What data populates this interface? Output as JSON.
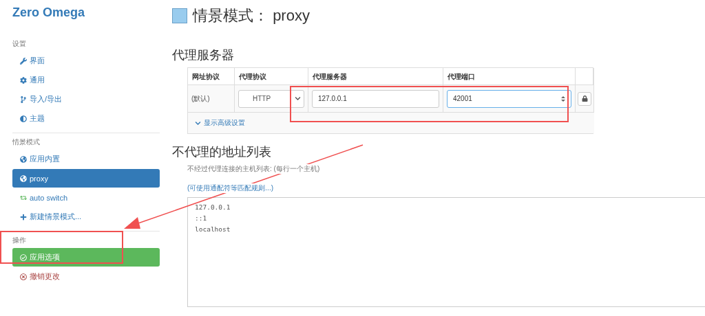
{
  "brand": "Zero Omega",
  "sidebar": {
    "sections": [
      {
        "title": "设置",
        "items": [
          {
            "label": "界面",
            "selected": false
          },
          {
            "label": "通用",
            "selected": false
          },
          {
            "label": "导入/导出",
            "selected": false
          },
          {
            "label": "主题",
            "selected": false
          }
        ]
      },
      {
        "title": "情景模式",
        "items": [
          {
            "label": "应用内置",
            "selected": false
          },
          {
            "label": "proxy",
            "selected": true
          },
          {
            "label": "auto switch",
            "selected": false
          },
          {
            "label": "新建情景模式...",
            "selected": false
          }
        ]
      },
      {
        "title": "操作",
        "items": [
          {
            "label": "应用选项",
            "kind": "apply"
          },
          {
            "label": "撤销更改",
            "kind": "discard"
          }
        ]
      }
    ]
  },
  "page": {
    "title_prefix": "情景模式：",
    "title": "proxy",
    "color": "#99ccee"
  },
  "proxy_servers": {
    "heading": "代理服务器",
    "columns": [
      "网址协议",
      "代理协议",
      "代理服务器",
      "代理端口"
    ],
    "row": {
      "scheme": "(默认)",
      "protocol": "HTTP",
      "server": "127.0.0.1",
      "port": "42001"
    },
    "advanced_link": "显示高级设置"
  },
  "bypass": {
    "heading": "不代理的地址列表",
    "description": "不经过代理连接的主机列表: (每行一个主机)",
    "link": "(可使用通配符等匹配规则...)",
    "lines": [
      "127.0.0.1",
      "::1",
      "localhost"
    ]
  }
}
